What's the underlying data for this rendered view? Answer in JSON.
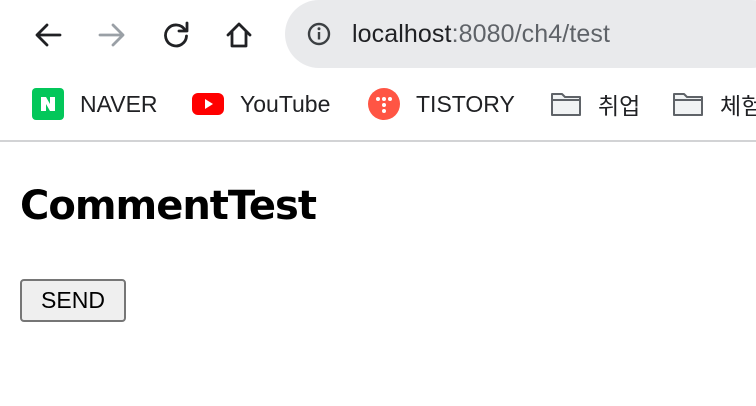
{
  "toolbar": {
    "url_host": "localhost",
    "url_path": ":8080/ch4/test",
    "icons": [
      "back-icon",
      "forward-icon",
      "reload-icon",
      "home-icon",
      "info-icon"
    ]
  },
  "bookmarks": {
    "items": [
      {
        "label": "NAVER",
        "icon": "naver-favicon"
      },
      {
        "label": "YouTube",
        "icon": "youtube-favicon"
      },
      {
        "label": "TISTORY",
        "icon": "tistory-favicon"
      },
      {
        "label": "취업",
        "icon": "folder-icon"
      },
      {
        "label": "체험",
        "icon": "folder-icon"
      }
    ]
  },
  "page": {
    "title": "CommentTest",
    "send_label": "SEND"
  },
  "colors": {
    "omnibox_bg": "#e9eaec",
    "naver": "#03c75a",
    "youtube": "#ff0000",
    "tistory": "#ff5544"
  }
}
